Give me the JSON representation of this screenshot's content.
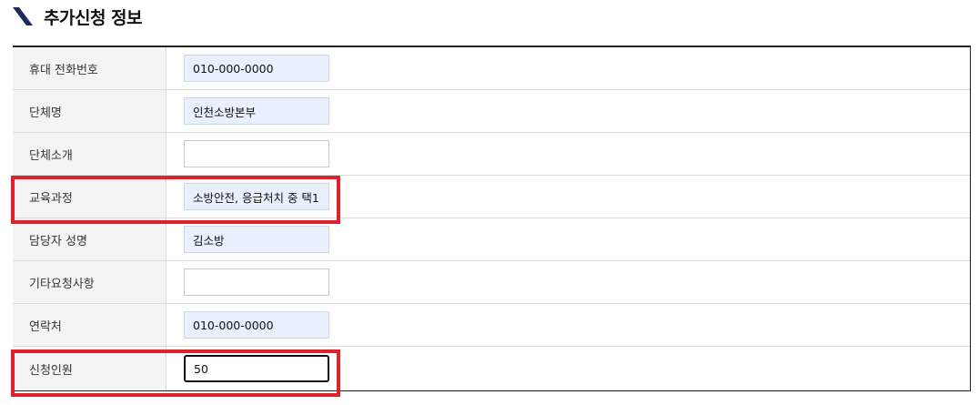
{
  "section": {
    "title": "추가신청 정보",
    "icon": "slash-icon"
  },
  "colors": {
    "highlight": "#e0202a",
    "autofill": "#e8f0fe",
    "label_bg": "#f4f4f4"
  },
  "form": {
    "rows": [
      {
        "label": "휴대 전화번호",
        "value": "010-000-0000",
        "state": "filled"
      },
      {
        "label": "단체명",
        "value": "인천소방본부",
        "state": "filled"
      },
      {
        "label": "단체소개",
        "value": "",
        "state": "empty"
      },
      {
        "label": "교육과정",
        "value": "소방안전, 응급처치 중 택1",
        "state": "filled"
      },
      {
        "label": "담당자 성명",
        "value": "김소방",
        "state": "filled"
      },
      {
        "label": "기타요청사항",
        "value": "",
        "state": "empty"
      },
      {
        "label": "연락처",
        "value": "010-000-0000",
        "state": "filled"
      },
      {
        "label": "신청인원",
        "value": "50",
        "state": "focused"
      }
    ]
  }
}
